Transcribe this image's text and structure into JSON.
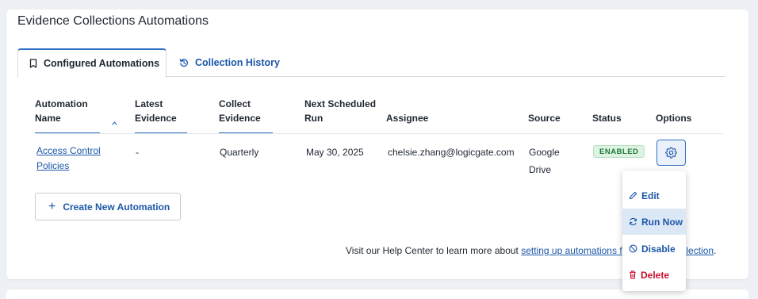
{
  "section_title": "Evidence Collections Automations",
  "tabs": [
    {
      "label": "Configured Automations",
      "icon": "bookmark-icon",
      "active": true
    },
    {
      "label": "Collection History",
      "icon": "history-icon",
      "active": false
    }
  ],
  "table": {
    "headers": {
      "automation_name_1": "Automation",
      "automation_name_2": "Name",
      "latest_evidence_1": "Latest",
      "latest_evidence_2": "Evidence",
      "collect_evidence_1": "Collect",
      "collect_evidence_2": "Evidence",
      "next_run_1": "Next Scheduled",
      "next_run_2": "Run",
      "assignee": "Assignee",
      "source": "Source",
      "status": "Status",
      "options": "Options"
    },
    "rows": [
      {
        "name_1": "Access Control",
        "name_2": "Policies",
        "latest_evidence": "-",
        "collect_evidence": "Quarterly",
        "next_run": "May 30, 2025",
        "assignee": "chelsie.zhang@logicgate.com",
        "source_1": "Google",
        "source_2": "Drive",
        "status": "ENABLED"
      }
    ]
  },
  "create_button": {
    "icon": "plus-icon",
    "label": "Create New Automation"
  },
  "help": {
    "prefix": "Visit our Help Center to learn more about ",
    "link": "setting up automations for evidence collection",
    "suffix": "."
  },
  "options_menu": {
    "items": [
      {
        "label": "Edit",
        "icon": "pencil-icon"
      },
      {
        "label": "Run Now",
        "icon": "refresh-icon"
      },
      {
        "label": "Disable",
        "icon": "block-icon"
      },
      {
        "label": "Delete",
        "icon": "trash-icon"
      }
    ]
  },
  "colors": {
    "accent": "#1c57a8",
    "tab_border": "#2f6fc4",
    "enabled_bg": "#dff3e3",
    "enabled_text": "#1e7a36",
    "danger": "#c8102e"
  }
}
